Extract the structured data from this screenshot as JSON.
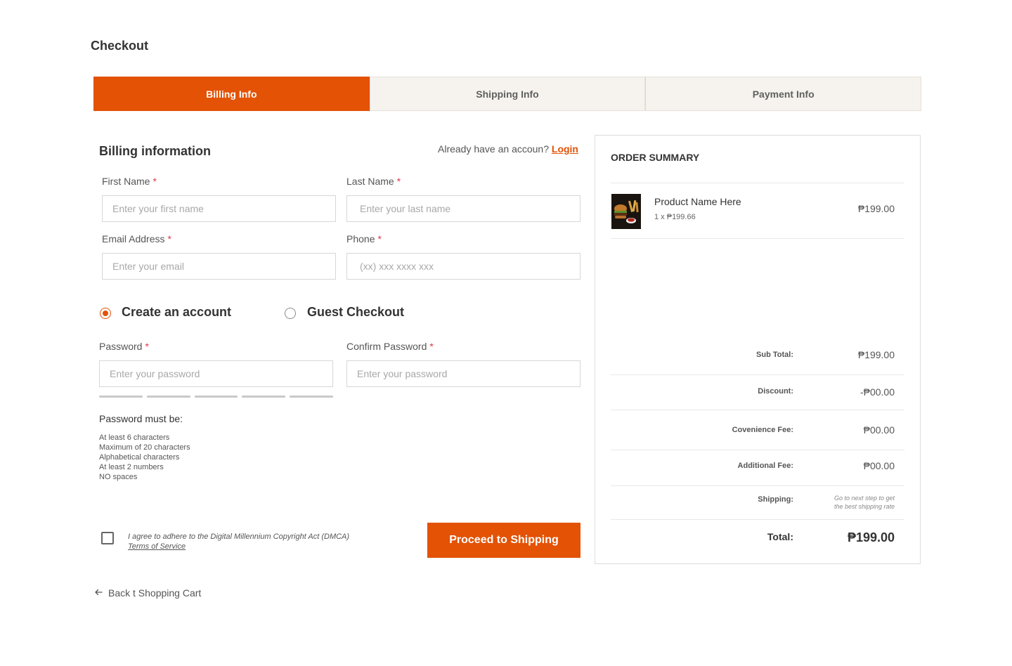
{
  "page": {
    "title": "Checkout"
  },
  "tabs": [
    {
      "label": "Billing Info",
      "active": true
    },
    {
      "label": "Shipping Info",
      "active": false
    },
    {
      "label": "Payment Info",
      "active": false
    }
  ],
  "billing": {
    "title": "Billing information",
    "account_prompt": "Already have an accoun?",
    "login_label": "Login",
    "fields": {
      "first_name": {
        "label": "First Name",
        "required": "*",
        "placeholder": "Enter your first name",
        "value": ""
      },
      "last_name": {
        "label": "Last Name",
        "required": "*",
        "placeholder": "Enter your last name",
        "value": ""
      },
      "email": {
        "label": "Email Address",
        "required": "*",
        "placeholder": "Enter your email",
        "value": ""
      },
      "phone": {
        "label": "Phone",
        "required": "*",
        "placeholder": "(xx) xxx xxxx xxx",
        "value": ""
      },
      "password": {
        "label": "Password",
        "required": "*",
        "placeholder": "Enter your password",
        "value": ""
      },
      "confirm_password": {
        "label": "Confirm Password",
        "required": "*",
        "placeholder": "Enter your password",
        "value": ""
      }
    },
    "account_options": {
      "create": {
        "label": "Create an account",
        "selected": true
      },
      "guest": {
        "label": "Guest Checkout",
        "selected": false
      }
    },
    "password_rules_title": "Password must be:",
    "password_rules": [
      "At least 6 characters",
      "Maximum of 20 characters",
      "Alphabetical characters",
      "At least 2 numbers",
      "NO spaces"
    ],
    "agreement_text": "I agree to adhere to the Digital Millennium Copyright Act (DMCA)",
    "terms_link": "Terms of Service",
    "agreement_checked": false,
    "proceed_label": "Proceed to Shipping",
    "back_label": "Back t Shopping Cart"
  },
  "summary": {
    "title": "ORDER SUMMARY",
    "item": {
      "name": "Product Name Here",
      "qty_price": "1 x ₱199.66",
      "price": "₱199.00"
    },
    "subtotal": {
      "label": "Sub Total:",
      "value": "₱199.00"
    },
    "discount": {
      "label": "Discount:",
      "value": "-₱00.00"
    },
    "convenience": {
      "label": "Covenience Fee:",
      "value": "₱00.00"
    },
    "additional": {
      "label": "Additional Fee:",
      "value": "₱00.00"
    },
    "shipping": {
      "label": "Shipping:",
      "note_line1": "Go to next step to get",
      "note_line2": "the best shipping rate"
    },
    "total": {
      "label": "Total:",
      "value": "₱199.00"
    }
  },
  "colors": {
    "accent": "#e35205",
    "tab_inactive_bg": "#f6f3ee",
    "required": "#e0384a"
  },
  "icons": {
    "back": "arrow-left-icon",
    "product": "burger-thumbnail"
  }
}
